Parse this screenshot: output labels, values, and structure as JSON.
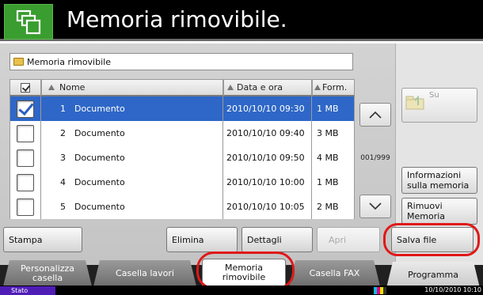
{
  "header": {
    "title": "Memoria rimovibile."
  },
  "path": {
    "label": "Memoria rimovibile"
  },
  "table": {
    "headers": {
      "name": "Nome",
      "date": "Data e ora",
      "size": "Form."
    },
    "rows": [
      {
        "num": "1",
        "name": "Documento",
        "date": "2010/10/10 09:30",
        "size": "1 MB",
        "selected": true
      },
      {
        "num": "2",
        "name": "Documento",
        "date": "2010/10/10 09:40",
        "size": "3 MB",
        "selected": false
      },
      {
        "num": "3",
        "name": "Documento",
        "date": "2010/10/10 09:50",
        "size": "4 MB",
        "selected": false
      },
      {
        "num": "4",
        "name": "Documento",
        "date": "2010/10/10 10:00",
        "size": "1 MB",
        "selected": false
      },
      {
        "num": "5",
        "name": "Documento",
        "date": "2010/10/10 10:05",
        "size": "2 MB",
        "selected": false
      }
    ],
    "page_indicator": "001/999"
  },
  "side": {
    "up_label": "Su",
    "info_label_1": "Informazioni",
    "info_label_2": "sulla memoria",
    "remove_label_1": "Rimuovi",
    "remove_label_2": "Memoria"
  },
  "actions": {
    "stampa": "Stampa",
    "elimina": "Elimina",
    "dettagli": "Dettagli",
    "apri": "Apri",
    "salva": "Salva file"
  },
  "tabs": {
    "personalizza_1": "Personalizza",
    "personalizza_2": "casella",
    "lavori": "Casella lavori",
    "memoria_1": "Memoria",
    "memoria_2": "rimovibile",
    "fax": "Casella FAX",
    "programma": "Programma"
  },
  "status": {
    "label": "Stato",
    "datetime": "10/10/2010  10:10"
  },
  "colors": {
    "header_icon_bg": "#3a9d2f",
    "selection": "#2e67c7",
    "highlight_ring": "#e01818",
    "status_bg": "#4f1cb6"
  }
}
